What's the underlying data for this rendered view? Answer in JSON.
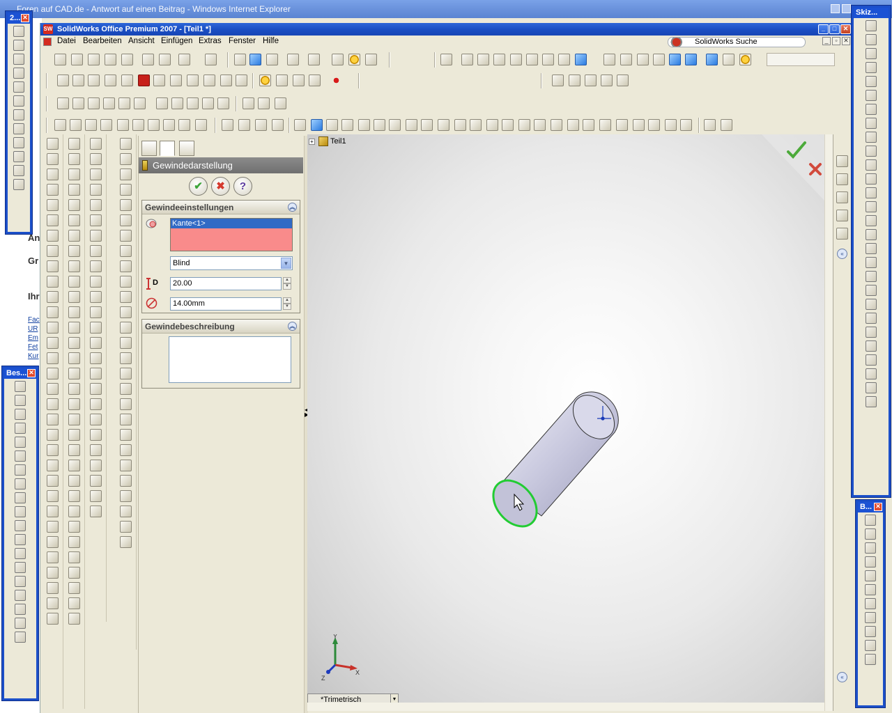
{
  "ie": {
    "title": "Foren auf CAD.de - Antwort auf einen Beitrag - Windows Internet Explorer",
    "page_fragments": [
      "Ant",
      "Gr",
      "Ihr",
      "Fac",
      "UR",
      "Em",
      "Fet",
      "Kur"
    ]
  },
  "floating_toolbars": {
    "top_left": {
      "title": "2..."
    },
    "left": {
      "title": "Bes..."
    },
    "right_top": {
      "title": "Skiz..."
    },
    "right_bottom": {
      "title": "B..."
    }
  },
  "sw": {
    "title": "SolidWorks Office Premium 2007 - [Teil1 *]",
    "menu": [
      "Datei",
      "Bearbeiten",
      "Ansicht",
      "Einfügen",
      "Extras",
      "Fenster",
      "Hilfe"
    ],
    "search_placeholder": "SolidWorks Suche"
  },
  "property_manager": {
    "title": "Gewindedarstellung",
    "group_settings": {
      "title": "Gewindeeinstellungen",
      "selected_edge": "Kante<1>",
      "end_condition": "Blind",
      "depth_label": "D",
      "depth_value": "20.00",
      "diameter_value": "14.00mm"
    },
    "group_description": {
      "title": "Gewindebeschreibung",
      "value": ""
    }
  },
  "graphics": {
    "tree_root": "Teil1",
    "view_orientation": "*Trimetrisch",
    "triad": {
      "x": "X",
      "y": "Y",
      "z": "Z"
    }
  },
  "colors": {
    "selection_highlight": "#22cc33",
    "pm_selection_list": "#f98b8b",
    "accept": "#3da53a",
    "cancel": "#d53a2e"
  }
}
